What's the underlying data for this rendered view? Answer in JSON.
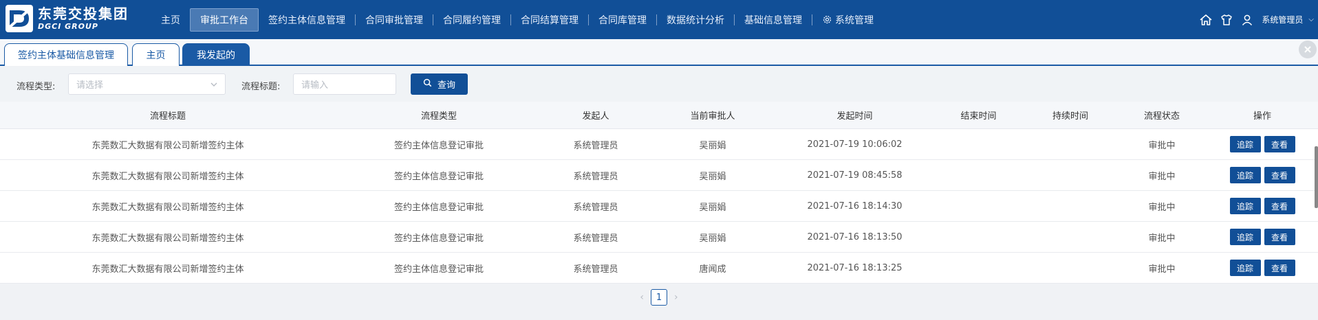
{
  "brand": {
    "name_cn": "东莞交投集团",
    "name_en": "DGCI GROUP",
    "color": "#114f97"
  },
  "nav": {
    "items": [
      {
        "label": "主页"
      },
      {
        "label": "审批工作台"
      },
      {
        "label": "签约主体信息管理"
      },
      {
        "label": "合同审批管理"
      },
      {
        "label": "合同履约管理"
      },
      {
        "label": "合同结算管理"
      },
      {
        "label": "合同库管理"
      },
      {
        "label": "数据统计分析"
      },
      {
        "label": "基础信息管理"
      },
      {
        "label": "系统管理"
      }
    ],
    "active_index": 1
  },
  "user": {
    "name": "系统管理员",
    "caret": "⌵"
  },
  "tabs": [
    {
      "label": "签约主体基础信息管理"
    },
    {
      "label": "主页"
    },
    {
      "label": "我发起的"
    }
  ],
  "filter": {
    "type_label": "流程类型:",
    "type_placeholder": "请选择",
    "title_label": "流程标题:",
    "title_placeholder": "请输入",
    "query_label": "查询"
  },
  "table": {
    "headers": [
      "流程标题",
      "流程类型",
      "发起人",
      "当前审批人",
      "发起时间",
      "结束时间",
      "持续时间",
      "流程状态",
      "操作"
    ],
    "rows": [
      {
        "title": "东莞数汇大数据有限公司新增签约主体",
        "type": "签约主体信息登记审批",
        "initiator": "系统管理员",
        "approver": "吴丽娟",
        "start": "2021-07-19 10:06:02",
        "end": "",
        "duration": "",
        "status": "审批中"
      },
      {
        "title": "东莞数汇大数据有限公司新增签约主体",
        "type": "签约主体信息登记审批",
        "initiator": "系统管理员",
        "approver": "吴丽娟",
        "start": "2021-07-19 08:45:58",
        "end": "",
        "duration": "",
        "status": "审批中"
      },
      {
        "title": "东莞数汇大数据有限公司新增签约主体",
        "type": "签约主体信息登记审批",
        "initiator": "系统管理员",
        "approver": "吴丽娟",
        "start": "2021-07-16 18:14:30",
        "end": "",
        "duration": "",
        "status": "审批中"
      },
      {
        "title": "东莞数汇大数据有限公司新增签约主体",
        "type": "签约主体信息登记审批",
        "initiator": "系统管理员",
        "approver": "吴丽娟",
        "start": "2021-07-16 18:13:50",
        "end": "",
        "duration": "",
        "status": "审批中"
      },
      {
        "title": "东莞数汇大数据有限公司新增签约主体",
        "type": "签约主体信息登记审批",
        "initiator": "系统管理员",
        "approver": "唐闻成",
        "start": "2021-07-16 18:13:25",
        "end": "",
        "duration": "",
        "status": "审批中"
      }
    ],
    "actions": {
      "track": "追踪",
      "view": "查看"
    }
  },
  "pagination": {
    "current": "1",
    "prev": "‹",
    "next": "›"
  },
  "icons": {
    "home": "home-icon",
    "skin": "shirt-icon",
    "user": "user-icon",
    "gear": "gear-icon",
    "search": "search-icon",
    "close": "close-all-icon"
  }
}
